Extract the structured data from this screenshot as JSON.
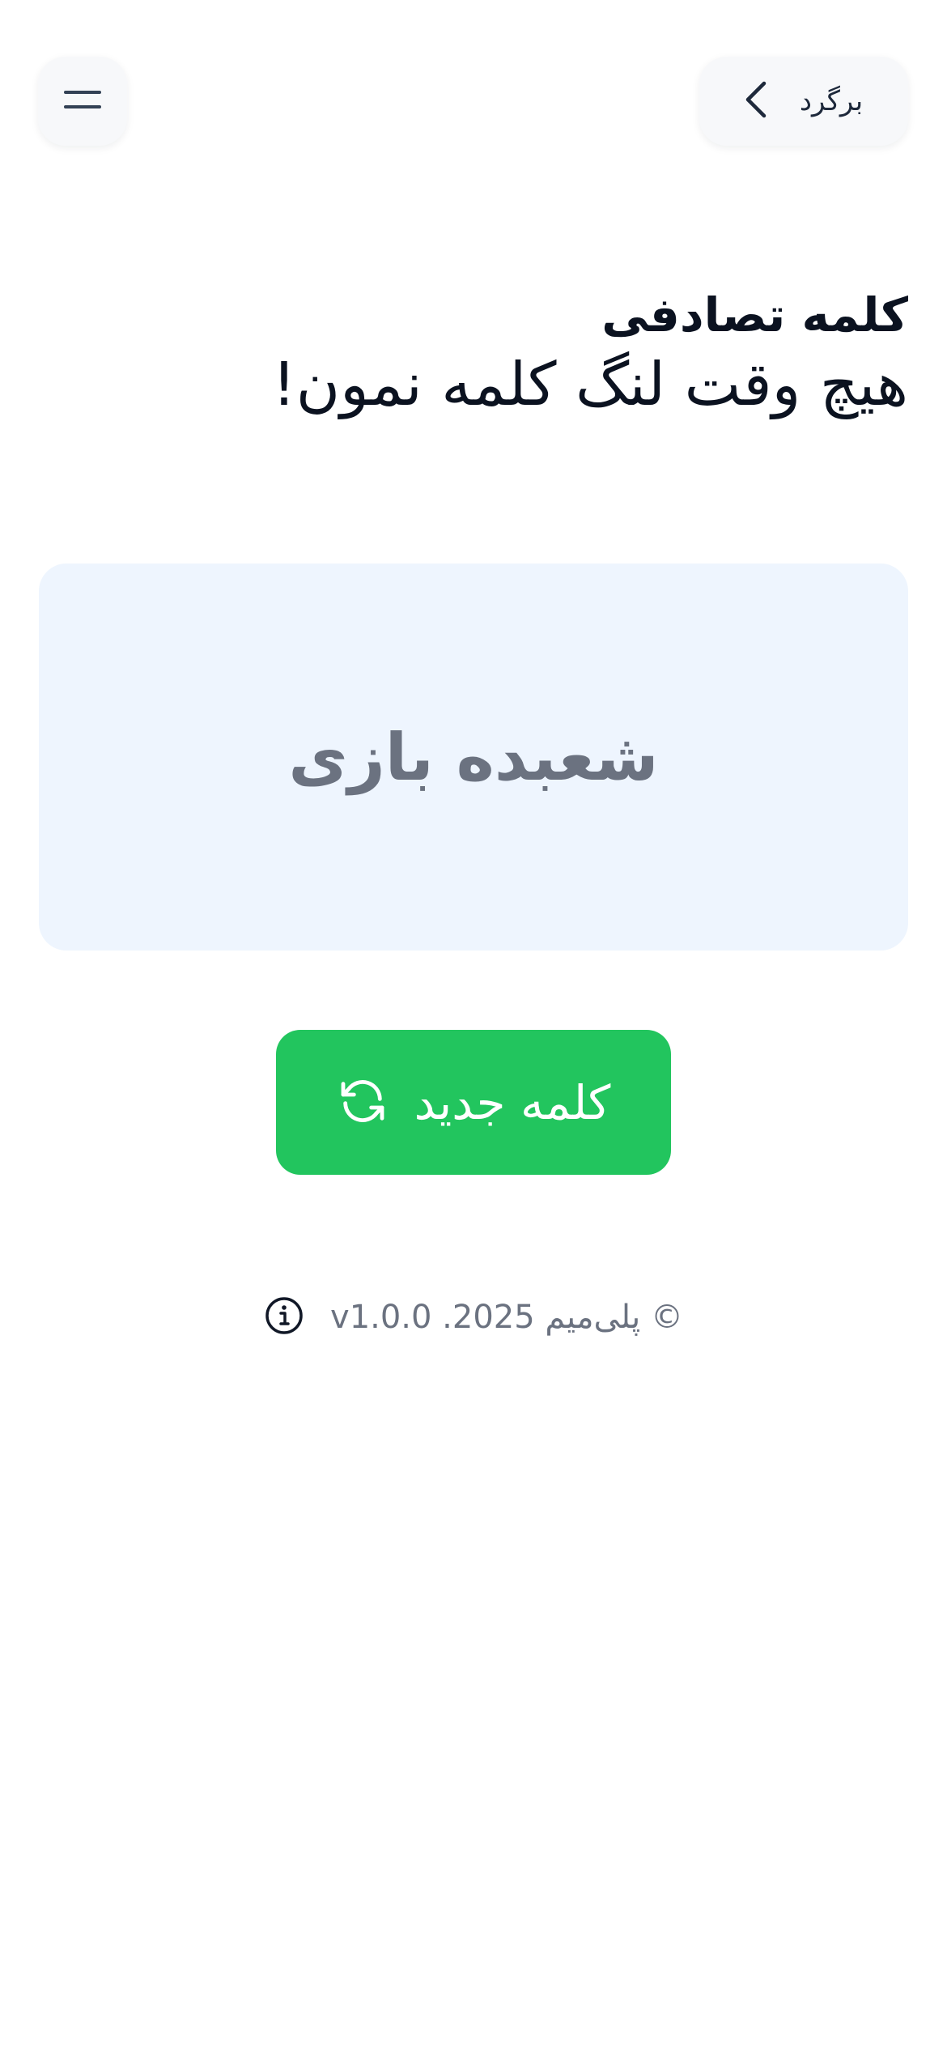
{
  "header": {
    "back_label": "برگرد",
    "back_icon": "chevron-left-icon",
    "menu_icon": "menu-icon"
  },
  "heading": {
    "title": "کلمه تصادفی",
    "subtitle": "هیچ وقت لنگ کلمه نمون!"
  },
  "word_card": {
    "word": "شعبده بازی"
  },
  "actions": {
    "new_word_label": "کلمه جدید",
    "new_word_icon": "refresh-icon"
  },
  "footer": {
    "text": "v1.0.0 .پلی‌میم 2025 ©",
    "info_icon": "info-icon"
  },
  "colors": {
    "accent": "#22c55e",
    "card_background": "#eef5fe",
    "muted_text": "#6b7280"
  }
}
